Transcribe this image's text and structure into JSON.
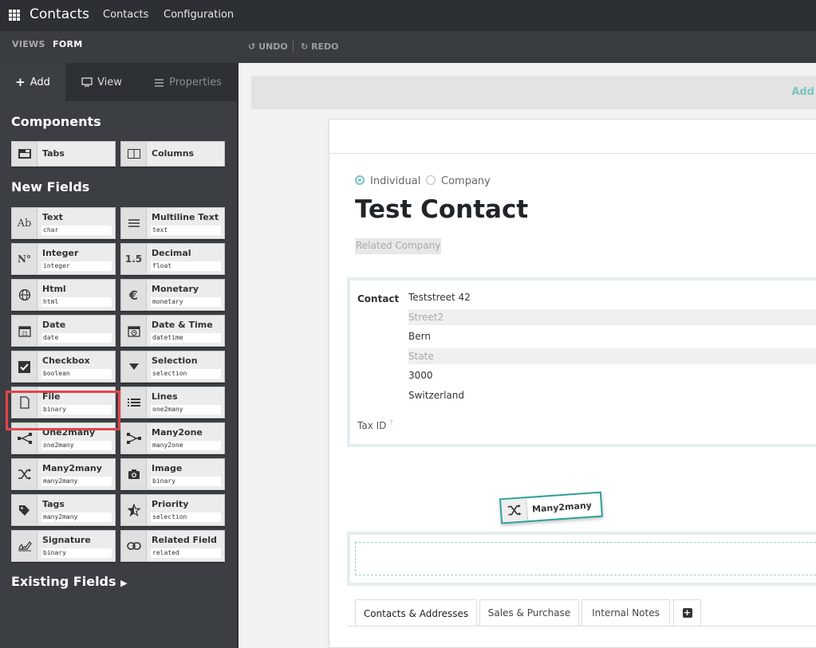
{
  "topbar": {
    "app_title": "Contacts",
    "menu": [
      "Contacts",
      "Configuration"
    ]
  },
  "studio": {
    "views_label": "VIEWS",
    "form_label": "FORM",
    "undo_label": "UNDO",
    "redo_label": "REDO"
  },
  "sidebar": {
    "tabs": [
      "Add",
      "View",
      "Properties"
    ],
    "components_title": "Components",
    "components": [
      "Tabs",
      "Columns"
    ],
    "new_fields_title": "New Fields",
    "fields": [
      {
        "label": "Text",
        "type": "char",
        "icon": "text-ab-icon"
      },
      {
        "label": "Multiline Text",
        "type": "text",
        "icon": "multiline-icon"
      },
      {
        "label": "Integer",
        "type": "integer",
        "icon": "number-icon"
      },
      {
        "label": "Decimal",
        "type": "float",
        "icon": "decimal-icon"
      },
      {
        "label": "Html",
        "type": "html",
        "icon": "globe-icon"
      },
      {
        "label": "Monetary",
        "type": "monetary",
        "icon": "euro-icon"
      },
      {
        "label": "Date",
        "type": "date",
        "icon": "calendar-icon"
      },
      {
        "label": "Date & Time",
        "type": "datetime",
        "icon": "calendar-clock-icon"
      },
      {
        "label": "Checkbox",
        "type": "boolean",
        "icon": "checkbox-icon"
      },
      {
        "label": "Selection",
        "type": "selection",
        "icon": "caret-down-icon"
      },
      {
        "label": "File",
        "type": "binary",
        "icon": "file-icon"
      },
      {
        "label": "Lines",
        "type": "one2many",
        "icon": "list-icon"
      },
      {
        "label": "One2many",
        "type": "one2many",
        "icon": "one2many-icon"
      },
      {
        "label": "Many2one",
        "type": "many2one",
        "icon": "many2one-icon"
      },
      {
        "label": "Many2many",
        "type": "many2many",
        "icon": "many2many-icon"
      },
      {
        "label": "Image",
        "type": "binary",
        "icon": "camera-icon"
      },
      {
        "label": "Tags",
        "type": "many2many",
        "icon": "tag-icon"
      },
      {
        "label": "Priority",
        "type": "selection",
        "icon": "star-icon"
      },
      {
        "label": "Signature",
        "type": "binary",
        "icon": "signature-icon"
      },
      {
        "label": "Related Field",
        "type": "related",
        "icon": "link-icon"
      }
    ],
    "existing_fields_title": "Existing Fields"
  },
  "form": {
    "add_label": "Add",
    "radio_individual": "Individual",
    "radio_company": "Company",
    "name": "Test Contact",
    "related_company_placeholder": "Related Company",
    "contact_label": "Contact",
    "street": "Teststreet 42",
    "street2_placeholder": "Street2",
    "city": "Bern",
    "state_placeholder": "State",
    "zip": "3000",
    "country": "Switzerland",
    "tax_id_label": "Tax ID",
    "tax_id_help": "?",
    "dragging_label": "Many2many",
    "notebook_tabs": [
      "Contacts & Addresses",
      "Sales & Purchase",
      "Internal Notes"
    ],
    "add_tab": "+"
  },
  "colors": {
    "accent": "#7cc4c1",
    "highlight": "#e0464a",
    "topbar": "#2c2f33",
    "sidebar": "#3b3f44"
  }
}
